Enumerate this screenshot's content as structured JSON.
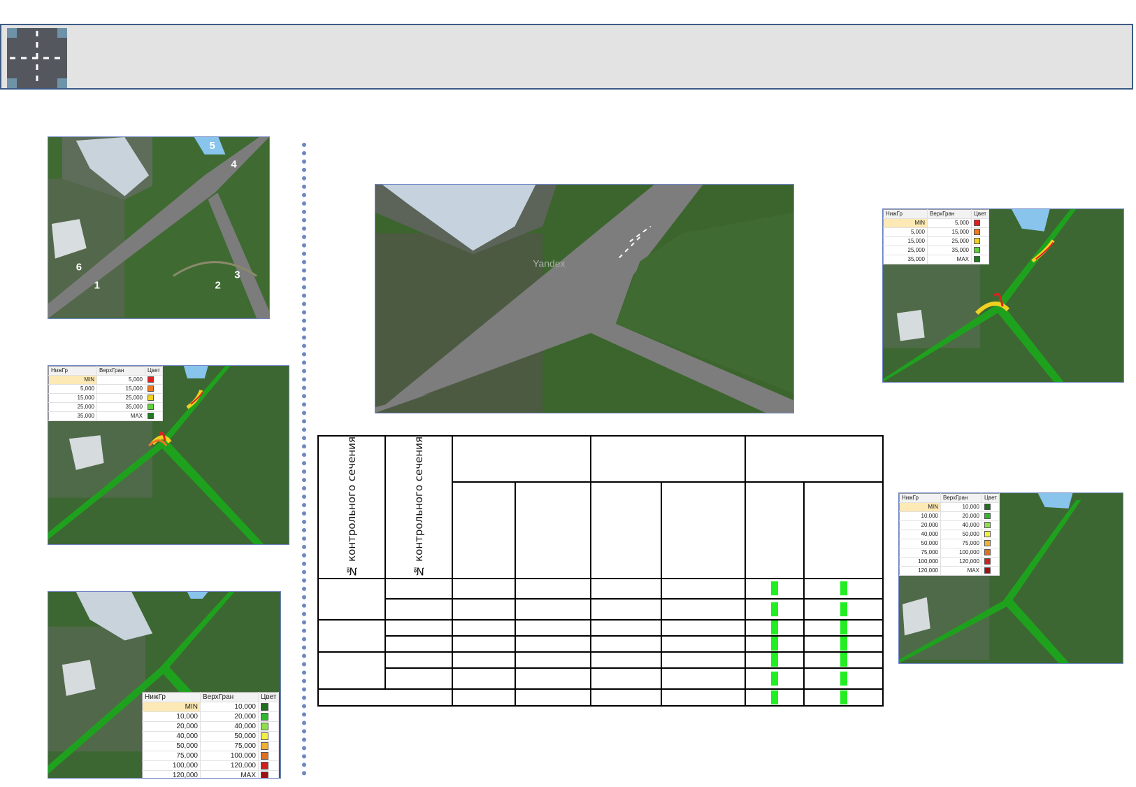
{
  "header": {
    "icon": "road-intersection-icon",
    "title": ""
  },
  "top_left_map": {
    "labels": [
      "1",
      "2",
      "3",
      "4",
      "5",
      "6"
    ]
  },
  "legend_5_class": {
    "columns": [
      "НижГр",
      "ВерхГран",
      "Цвет"
    ],
    "rows": [
      {
        "low": "MIN",
        "high": "5,000",
        "color": "#e02020"
      },
      {
        "low": "5,000",
        "high": "15,000",
        "color": "#f07820"
      },
      {
        "low": "15,000",
        "high": "25,000",
        "color": "#f0d020"
      },
      {
        "low": "25,000",
        "high": "35,000",
        "color": "#60d040"
      },
      {
        "low": "35,000",
        "high": "MAX",
        "color": "#207a20"
      }
    ]
  },
  "legend_8_class": {
    "columns": [
      "НижГр",
      "ВерхГран",
      "Цвет"
    ],
    "rows": [
      {
        "low": "MIN",
        "high": "10,000",
        "color": "#1e6e1e"
      },
      {
        "low": "10,000",
        "high": "20,000",
        "color": "#2fb82f"
      },
      {
        "low": "20,000",
        "high": "40,000",
        "color": "#8ee04a"
      },
      {
        "low": "40,000",
        "high": "50,000",
        "color": "#f2f040"
      },
      {
        "low": "50,000",
        "high": "75,000",
        "color": "#f2b030"
      },
      {
        "low": "75,000",
        "high": "100,000",
        "color": "#e07020"
      },
      {
        "low": "100,000",
        "high": "120,000",
        "color": "#d02020"
      },
      {
        "low": "120,000",
        "high": "MAX",
        "color": "#a01010"
      }
    ]
  },
  "center_map": {
    "watermark": "Yandex"
  },
  "table": {
    "col1_header": "№ контрольного сечения",
    "col2_header": "№ контрольного сечения",
    "mark_color": "#22ee22"
  },
  "colors": {
    "header_border": "#3c5a86",
    "header_bg": "#e3e3e3",
    "divider": "#6f86c4",
    "road_green": "#1fa81f"
  }
}
